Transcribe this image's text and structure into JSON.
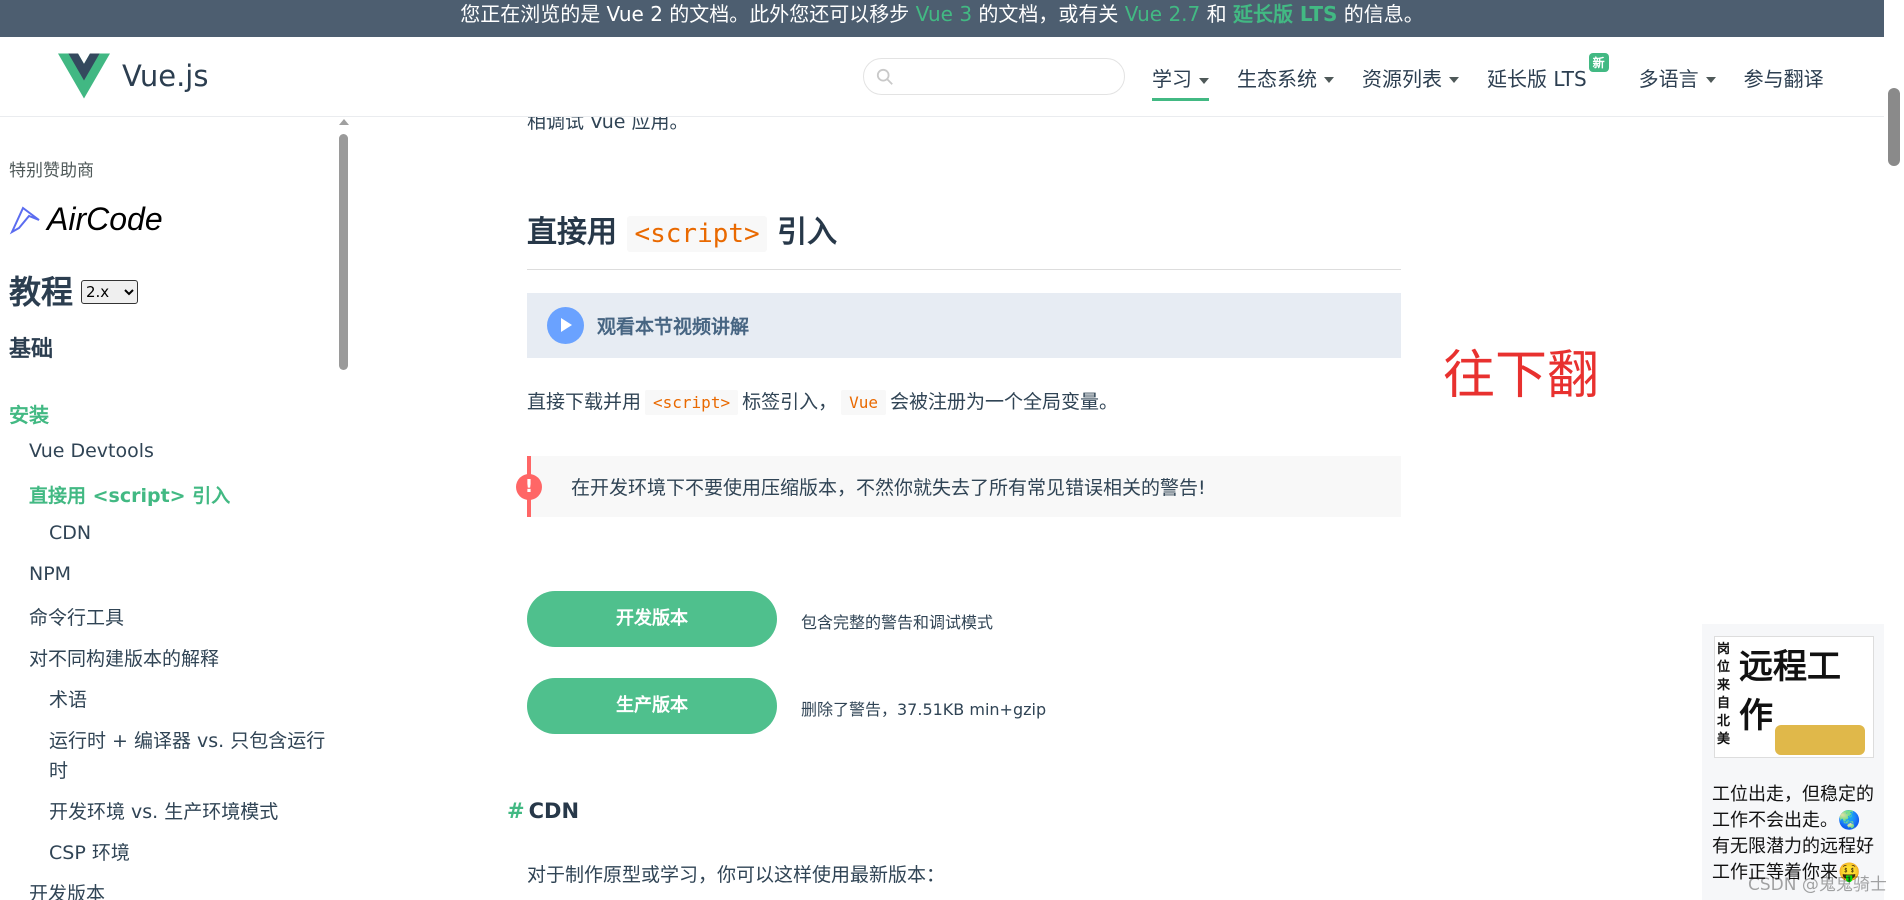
{
  "banner": {
    "part1": "您正在浏览的是 Vue 2 的文档。此外您还可以移步 ",
    "vue3": "Vue 3",
    "part2": " 的文档，或有关 ",
    "vue27": "Vue 2.7",
    "part3": " 和 ",
    "lts": "延长版 LTS",
    "part4": " 的信息。"
  },
  "header": {
    "logo_text": "Vue.js",
    "search_placeholder": "",
    "nav": [
      {
        "label": "学习",
        "dropdown": true,
        "active": true
      },
      {
        "label": "生态系统",
        "dropdown": true
      },
      {
        "label": "资源列表",
        "dropdown": true
      },
      {
        "label": "延长版 LTS",
        "badge": "新"
      },
      {
        "label": "多语言",
        "dropdown": true
      },
      {
        "label": "参与翻译"
      }
    ]
  },
  "sidebar": {
    "sponsor_label": "特别赞助商",
    "sponsor_name": "AirCode",
    "tutorial_title": "教程",
    "version_selected": "2.x",
    "section_title": "基础",
    "items": [
      {
        "label": "安装",
        "level": 0,
        "state": "active"
      },
      {
        "label": "Vue Devtools",
        "level": 1
      },
      {
        "label": "直接用 <script> 引入",
        "level": 1,
        "state": "current"
      },
      {
        "label": "CDN",
        "level": 2
      },
      {
        "label": "NPM",
        "level": 1
      },
      {
        "label": "命令行工具",
        "level": 1
      },
      {
        "label": "对不同构建版本的解释",
        "level": 1
      },
      {
        "label": "术语",
        "level": 2
      },
      {
        "label": "运行时 + 编译器 vs. 只包含运行",
        "level": 2
      },
      {
        "label": "时",
        "level": 2
      },
      {
        "label": "开发环境 vs. 生产环境模式",
        "level": 2
      },
      {
        "label": "CSP 环境",
        "level": 2
      },
      {
        "label": "开发版本",
        "level": 1
      }
    ]
  },
  "main": {
    "cut_text": "相调试 Vue 应用。",
    "heading_pre": "直接用 ",
    "heading_code": "<script>",
    "heading_post": " 引入",
    "video_label": "观看本节视频讲解",
    "p1_pre": "直接下载并用",
    "p1_code1": "<script>",
    "p1_mid": "标签引入，",
    "p1_code2": "Vue",
    "p1_post": "会被注册为一个全局变量。",
    "warning": "在开发环境下不要使用压缩版本，不然你就失去了所有常见错误相关的警告!",
    "dev_button": "开发版本",
    "dev_desc": "包含完整的警告和调试模式",
    "prod_button": "生产版本",
    "prod_desc": "删除了警告，37.51KB min+gzip",
    "cdn_hash": "#",
    "cdn_heading": "CDN",
    "p2": "对于制作原型或学习，你可以这样使用最新版本："
  },
  "annotation": "往下翻",
  "ad": {
    "img_big": "远程工作",
    "img_side": "岗位来自北美",
    "text": "工位出走，但稳定的工作不会出走。🌏有无限潜力的远程好工作正等着你来🤑"
  },
  "watermark": "CSDN @鬼鬼骑士",
  "colors": {
    "accent": "#42b983",
    "banner_bg": "#4d5e70",
    "warning": "#ff6666",
    "annotation": "#e8312f"
  }
}
